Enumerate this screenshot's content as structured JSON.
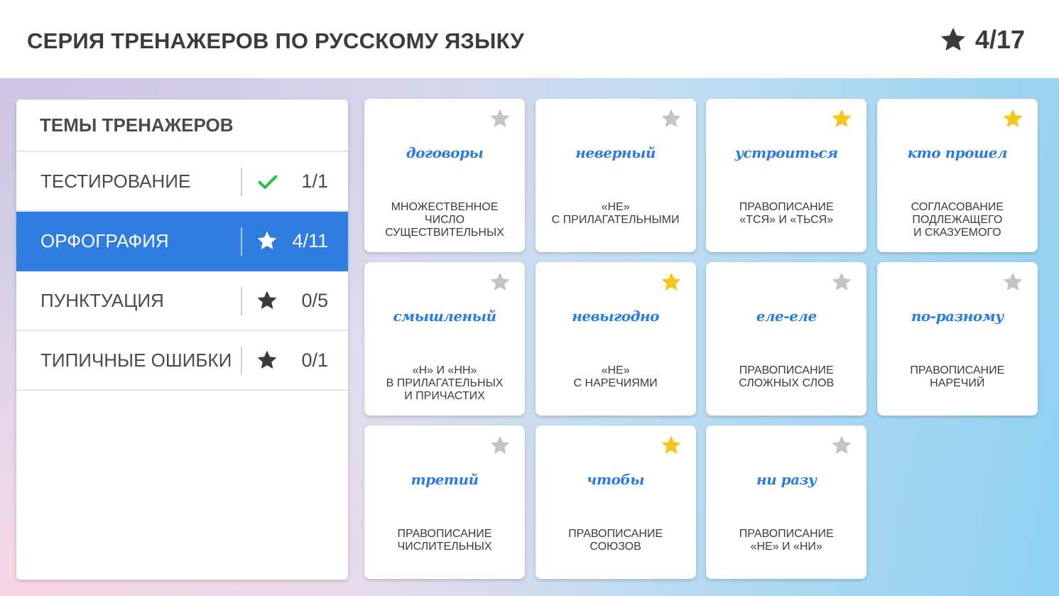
{
  "header": {
    "title": "СЕРИЯ ТРЕНАЖЕРОВ ПО РУССКОМУ ЯЗЫКУ",
    "score_icon": "star-icon",
    "score": "4/17"
  },
  "sidebar": {
    "title": "ТЕМЫ ТРЕНАЖЕРОВ",
    "items": [
      {
        "label": "ТЕСТИРОВАНИЕ",
        "icon": "check-icon",
        "count": "1/1",
        "active": false
      },
      {
        "label": "ОРФОГРАФИЯ",
        "icon": "star-icon",
        "count": "4/11",
        "active": true
      },
      {
        "label": "ПУНКТУАЦИЯ",
        "icon": "star-icon",
        "count": "0/5",
        "active": false
      },
      {
        "label": "ТИПИЧНЫЕ ОШИБКИ",
        "icon": "star-icon",
        "count": "0/1",
        "active": false
      }
    ]
  },
  "cards": [
    {
      "word": "договоры",
      "desc": "МНОЖЕСТВЕННОЕ\nЧИСЛО\nСУЩЕСТВИТЕЛЬНЫХ",
      "starred": false
    },
    {
      "word": "неверный",
      "desc": "«НЕ»\nС ПРИЛАГАТЕЛЬНЫМИ",
      "starred": false
    },
    {
      "word": "устроиться",
      "desc": "ПРАВОПИСАНИЕ\n«ТСЯ» И «ТЬСЯ»",
      "starred": true
    },
    {
      "word": "кто прошел",
      "desc": "СОГЛАСОВАНИЕ\nПОДЛЕЖАЩЕГО\nИ СКАЗУЕМОГО",
      "starred": true
    },
    {
      "word": "смышленый",
      "desc": "«Н» И «НН»\nВ ПРИЛАГАТЕЛЬНЫХ\nИ ПРИЧАСТИХ",
      "starred": false
    },
    {
      "word": "невыгодно",
      "desc": "«НЕ»\nС НАРЕЧИЯМИ",
      "starred": true
    },
    {
      "word": "еле-еле",
      "desc": "ПРАВОПИСАНИЕ\nСЛОЖНЫХ СЛОВ",
      "starred": false
    },
    {
      "word": "по-разному",
      "desc": "ПРАВОПИСАНИЕ\nНАРЕЧИЙ",
      "starred": false
    },
    {
      "word": "третий",
      "desc": "ПРАВОПИСАНИЕ\nЧИСЛИТЕЛЬНЫХ",
      "starred": false
    },
    {
      "word": "чтобы",
      "desc": "ПРАВОПИСАНИЕ\nСОЮЗОВ",
      "starred": true
    },
    {
      "word": "ни разу",
      "desc": "ПРАВОПИСАНИЕ\n«НЕ» И «НИ»",
      "starred": false
    }
  ],
  "colors": {
    "accent": "#2f7de1",
    "word": "#2b7be3",
    "star_on": "#f7c51b",
    "star_off": "#c4c4c4",
    "check": "#2bbf45"
  }
}
